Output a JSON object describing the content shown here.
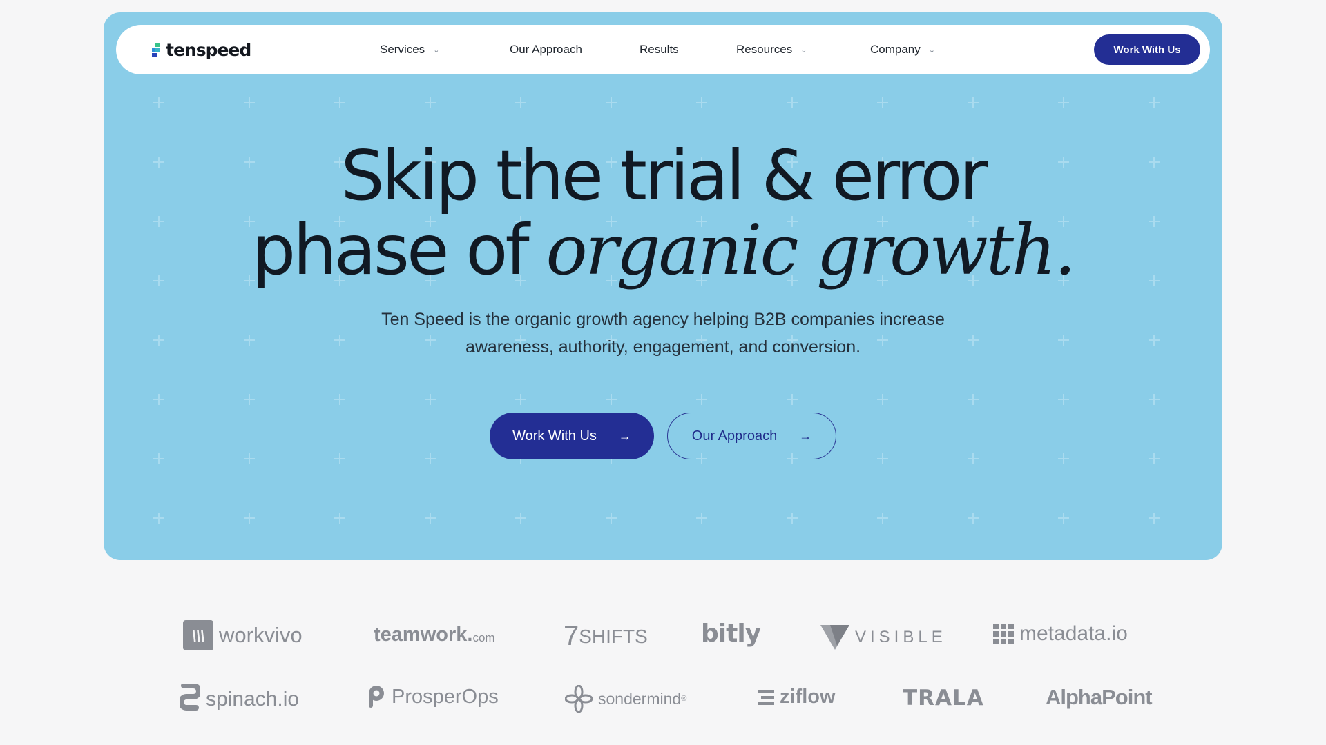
{
  "brand": {
    "name": "tenspeed",
    "colors": {
      "accent": "#232e94",
      "hero_bg": "#8acde8",
      "logo_gray": "#8a8d94"
    }
  },
  "nav": {
    "items": [
      {
        "label": "Services",
        "has_dropdown": true
      },
      {
        "label": "Our Approach",
        "has_dropdown": false
      },
      {
        "label": "Results",
        "has_dropdown": false
      },
      {
        "label": "Resources",
        "has_dropdown": true
      },
      {
        "label": "Company",
        "has_dropdown": true
      }
    ],
    "cta": "Work With Us",
    "chevron_icon": "chevron-down-icon"
  },
  "hero": {
    "headline_line1": "Skip the trial & error",
    "headline_line2_plain": "phase of ",
    "headline_line2_emphasis": "organic growth.",
    "subheadline_line1": "Ten Speed is the organic growth agency helping B2B companies increase",
    "subheadline_line2": "awareness, authority, engagement, and conversion.",
    "primary_button": "Work With Us",
    "secondary_button": "Our Approach",
    "arrow_icon": "arrow-right-icon"
  },
  "client_logos": {
    "row1": [
      {
        "text": "workvivo",
        "icon": "workvivo-logo"
      },
      {
        "text": "teamwork.",
        "suffix": "com",
        "icon": "teamwork-logo"
      },
      {
        "text": "SHIFTS",
        "prefix": "7",
        "icon": "7shifts-logo"
      },
      {
        "text": "bitly",
        "icon": "bitly-logo"
      },
      {
        "text": "VISIBLE",
        "icon": "visible-logo"
      },
      {
        "text": "metadata.io",
        "icon": "metadata-logo"
      }
    ],
    "row2": [
      {
        "text": "spinach.io",
        "icon": "spinach-logo"
      },
      {
        "text": "ProsperOps",
        "icon": "prosperops-logo"
      },
      {
        "text": "sondermind",
        "suffix": "®",
        "icon": "sondermind-logo"
      },
      {
        "text": "ziflow",
        "icon": "ziflow-logo"
      },
      {
        "text": "TRALA",
        "icon": "trala-logo"
      },
      {
        "text": "AlphaPoint",
        "icon": "alphapoint-logo"
      }
    ]
  }
}
